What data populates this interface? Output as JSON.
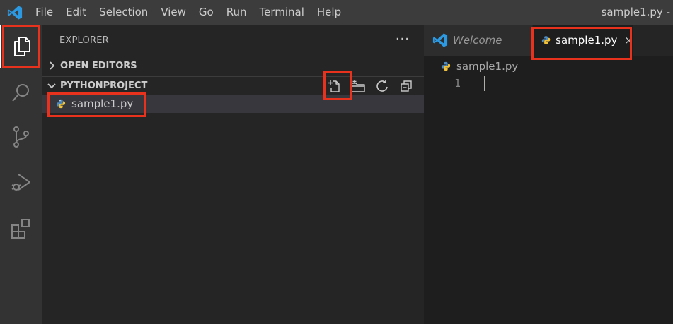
{
  "window": {
    "title": "sample1.py -",
    "menu": [
      "File",
      "Edit",
      "Selection",
      "View",
      "Go",
      "Run",
      "Terminal",
      "Help"
    ]
  },
  "colors": {
    "vscode_blue": "#2b9ae2",
    "highlight": "#e8321e",
    "python_blue": "#4e8cc2",
    "python_yellow": "#f2c33a"
  },
  "activity_bar": {
    "items": [
      "explorer-icon",
      "search-icon",
      "source-control-icon",
      "run-debug-icon",
      "extensions-icon"
    ]
  },
  "sidebar": {
    "title": "EXPLORER",
    "more": "···",
    "open_editors_label": "OPEN EDITORS",
    "project_label": "PYTHONPROJECT",
    "toolbar": [
      "new-file-icon",
      "new-folder-icon",
      "refresh-icon",
      "collapse-all-icon"
    ],
    "files": [
      {
        "name": "sample1.py",
        "icon": "python-icon"
      }
    ]
  },
  "editor": {
    "tabs": [
      {
        "label": "Welcome",
        "icon": "vscode-icon"
      },
      {
        "label": "sample1.py",
        "icon": "python-icon",
        "close": "×"
      }
    ],
    "breadcrumb": "sample1.py",
    "line_numbers": [
      "1"
    ]
  }
}
